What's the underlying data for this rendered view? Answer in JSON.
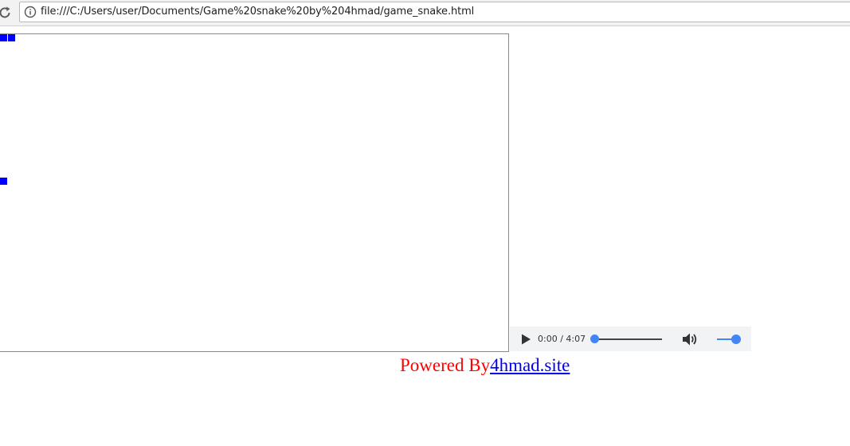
{
  "browser": {
    "url": "file:///C:/Users/user/Documents/Game%20snake%20by%204hmad/game_snake.html",
    "icons": {
      "reload": "reload-icon",
      "info": "info-icon"
    }
  },
  "game": {
    "snake_color": "#0000ff",
    "food_color": "#0000ff"
  },
  "audio": {
    "time_text": "0:00 / 4:07",
    "progress": 0,
    "volume": 1,
    "accent_color": "#4285f4",
    "icons": {
      "play": "play-icon",
      "volume": "volume-icon"
    }
  },
  "footer": {
    "prefix_text": "Powered By",
    "prefix_color": "#ff0000",
    "link_text": "4hmad.site",
    "link_color": "#0000ee"
  }
}
